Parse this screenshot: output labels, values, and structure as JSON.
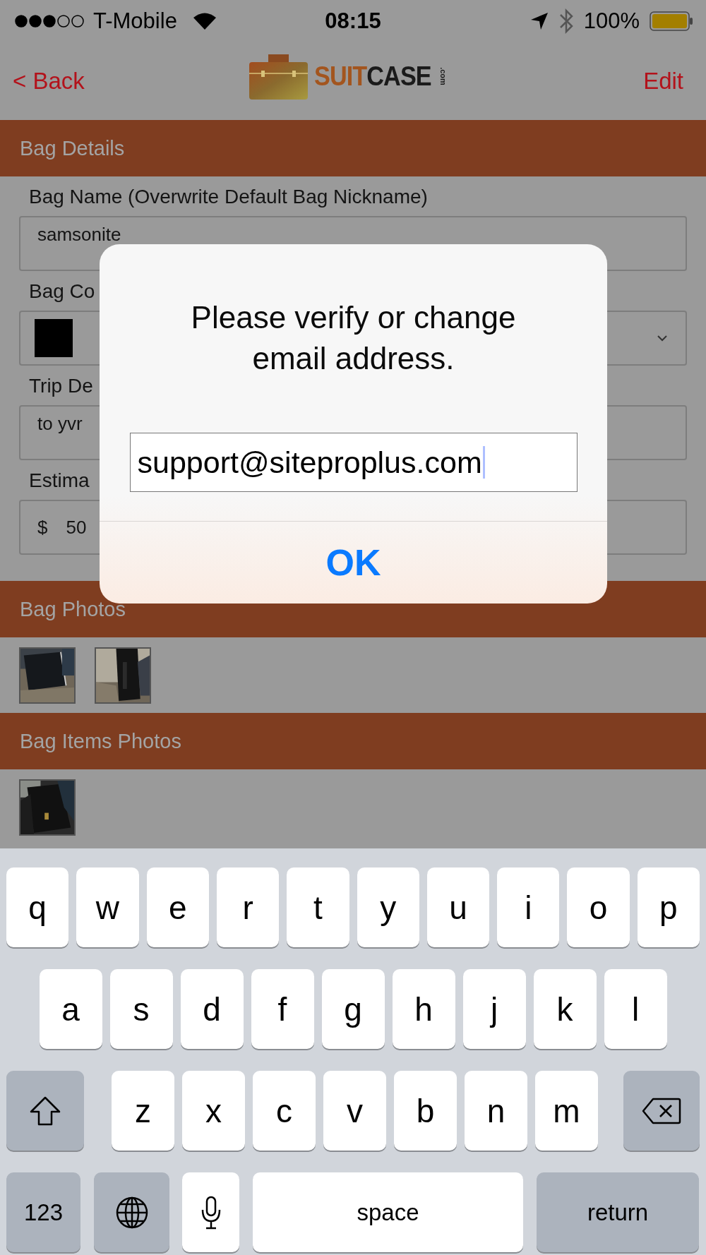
{
  "status_bar": {
    "carrier": "T-Mobile",
    "time": "08:15",
    "battery": "100%"
  },
  "nav": {
    "back": "< Back",
    "logo_a": "SUIT",
    "logo_b": "CASE",
    "logo_suffix": ".com",
    "edit": "Edit"
  },
  "sections": [
    {
      "title": "Bag Details",
      "fields": [
        {
          "kind": "text",
          "label": "Bag Name (Overwrite Default Bag Nickname)",
          "value": "samsonite"
        },
        {
          "kind": "select",
          "label": "Bag Co",
          "color": "#000000"
        },
        {
          "kind": "text",
          "label": "Trip De",
          "value": "to yvr"
        },
        {
          "kind": "currency",
          "label": "Estima",
          "prefix": "$",
          "value": "50"
        }
      ]
    },
    {
      "title": "Bag Photos"
    },
    {
      "title": "Bag Items Photos"
    }
  ],
  "dialog": {
    "title": "Please verify or change email address.",
    "value": "support@siteproplus.com",
    "button": "OK"
  },
  "keyboard": {
    "rows": [
      {
        "keys": [
          {
            "kind": "letter",
            "label": "q"
          },
          {
            "kind": "letter",
            "label": "w"
          },
          {
            "kind": "letter",
            "label": "e"
          },
          {
            "kind": "letter",
            "label": "r"
          },
          {
            "kind": "letter",
            "label": "t"
          },
          {
            "kind": "letter",
            "label": "y"
          },
          {
            "kind": "letter",
            "label": "u"
          },
          {
            "kind": "letter",
            "label": "i"
          },
          {
            "kind": "letter",
            "label": "o"
          },
          {
            "kind": "letter",
            "label": "p"
          }
        ]
      },
      {
        "keys": [
          {
            "kind": "letter",
            "label": "a"
          },
          {
            "kind": "letter",
            "label": "s"
          },
          {
            "kind": "letter",
            "label": "d"
          },
          {
            "kind": "letter",
            "label": "f"
          },
          {
            "kind": "letter",
            "label": "g"
          },
          {
            "kind": "letter",
            "label": "h"
          },
          {
            "kind": "letter",
            "label": "j"
          },
          {
            "kind": "letter",
            "label": "k"
          },
          {
            "kind": "letter",
            "label": "l"
          }
        ]
      },
      {
        "keys": [
          {
            "kind": "shift"
          },
          {
            "kind": "letter",
            "label": "z"
          },
          {
            "kind": "letter",
            "label": "x"
          },
          {
            "kind": "letter",
            "label": "c"
          },
          {
            "kind": "letter",
            "label": "v"
          },
          {
            "kind": "letter",
            "label": "b"
          },
          {
            "kind": "letter",
            "label": "n"
          },
          {
            "kind": "letter",
            "label": "m"
          },
          {
            "kind": "backspace"
          }
        ]
      },
      {
        "keys": [
          {
            "kind": "mode",
            "label": "123"
          },
          {
            "kind": "globe"
          },
          {
            "kind": "mic"
          },
          {
            "kind": "space",
            "label": "space"
          },
          {
            "kind": "return",
            "label": "return"
          }
        ]
      }
    ]
  }
}
